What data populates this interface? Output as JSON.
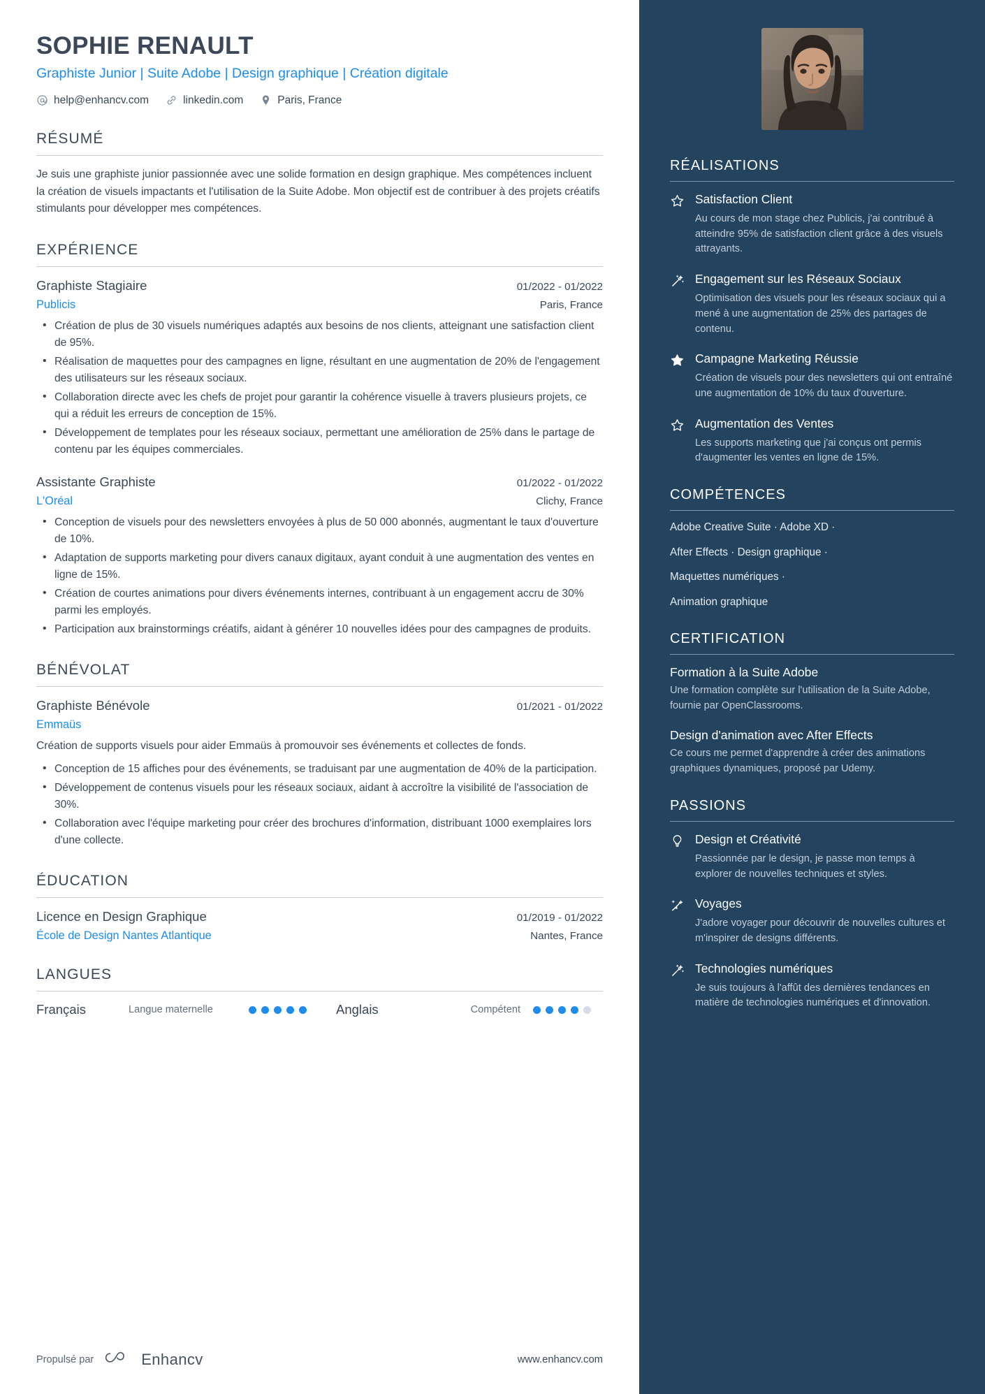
{
  "header": {
    "name": "SOPHIE RENAULT",
    "headline": "Graphiste Junior | Suite Adobe | Design graphique | Création digitale",
    "contacts": [
      {
        "icon": "at-icon",
        "text": "help@enhancv.com"
      },
      {
        "icon": "link-icon",
        "text": "linkedin.com"
      },
      {
        "icon": "location-pin-icon",
        "text": "Paris, France"
      }
    ]
  },
  "summary": {
    "title": "RÉSUMÉ",
    "text": "Je suis une graphiste junior passionnée avec une solide formation en design graphique. Mes compétences incluent la création de visuels impactants et l'utilisation de la Suite Adobe. Mon objectif est de contribuer à des projets créatifs stimulants pour développer mes compétences."
  },
  "experience": {
    "title": "EXPÉRIENCE",
    "entries": [
      {
        "role": "Graphiste Stagiaire",
        "date": "01/2022 - 01/2022",
        "company": "Publicis",
        "location": "Paris, France",
        "bullets": [
          "Création de plus de 30 visuels numériques adaptés aux besoins de nos clients, atteignant une satisfaction client de 95%.",
          "Réalisation de maquettes pour des campagnes en ligne, résultant en une augmentation de 20% de l'engagement des utilisateurs sur les réseaux sociaux.",
          "Collaboration directe avec les chefs de projet pour garantir la cohérence visuelle à travers plusieurs projets, ce qui a réduit les erreurs de conception de 15%.",
          "Développement de templates pour les réseaux sociaux, permettant une amélioration de 25% dans le partage de contenu par les équipes commerciales."
        ]
      },
      {
        "role": "Assistante Graphiste",
        "date": "01/2022 - 01/2022",
        "company": "L'Oréal",
        "location": "Clichy, France",
        "bullets": [
          "Conception de visuels pour des newsletters envoyées à plus de 50 000 abonnés, augmentant le taux d'ouverture de 10%.",
          "Adaptation de supports marketing pour divers canaux digitaux, ayant conduit à une augmentation des ventes en ligne de 15%.",
          "Création de courtes animations pour divers événements internes, contribuant à un engagement accru de 30% parmi les employés.",
          "Participation aux brainstormings créatifs, aidant à générer 10 nouvelles idées pour des campagnes de produits."
        ]
      }
    ]
  },
  "volunteering": {
    "title": "BÉNÉVOLAT",
    "entries": [
      {
        "role": "Graphiste Bénévole",
        "date": "01/2021 - 01/2022",
        "company": "Emmaüs",
        "location": "",
        "description": "Création de supports visuels pour aider Emmaüs à promouvoir ses événements et collectes de fonds.",
        "bullets": [
          "Conception de 15 affiches pour des événements, se traduisant par une augmentation de 40% de la participation.",
          "Développement de contenus visuels pour les réseaux sociaux, aidant à accroître la visibilité de l'association de 30%.",
          "Collaboration avec l'équipe marketing pour créer des brochures d'information, distribuant 1000 exemplaires lors d'une collecte."
        ]
      }
    ]
  },
  "education": {
    "title": "ÉDUCATION",
    "entries": [
      {
        "degree": "Licence en Design Graphique",
        "date": "01/2019 - 01/2022",
        "school": "École de Design Nantes Atlantique",
        "location": "Nantes, France"
      }
    ]
  },
  "languages": {
    "title": "LANGUES",
    "items": [
      {
        "name": "Français",
        "level": "Langue maternelle",
        "filled": 5,
        "total": 5
      },
      {
        "name": "Anglais",
        "level": "Compétent",
        "filled": 4,
        "total": 5
      }
    ]
  },
  "achievements": {
    "title": "RÉALISATIONS",
    "items": [
      {
        "icon": "star-outline-icon",
        "title": "Satisfaction Client",
        "description": "Au cours de mon stage chez Publicis, j'ai contribué à atteindre 95% de satisfaction client grâce à des visuels attrayants."
      },
      {
        "icon": "magic-wand-icon",
        "title": "Engagement sur les Réseaux Sociaux",
        "description": "Optimisation des visuels pour les réseaux sociaux qui a mené à une augmentation de 25% des partages de contenu."
      },
      {
        "icon": "star-filled-icon",
        "title": "Campagne Marketing Réussie",
        "description": "Création de visuels pour des newsletters qui ont entraîné une augmentation de 10% du taux d'ouverture."
      },
      {
        "icon": "star-outline-icon",
        "title": "Augmentation des Ventes",
        "description": "Les supports marketing que j'ai conçus ont permis d'augmenter les ventes en ligne de 15%."
      }
    ]
  },
  "skills": {
    "title": "COMPÉTENCES",
    "lines": [
      "Adobe Creative Suite · Adobe XD ·",
      "After Effects · Design graphique ·",
      "Maquettes numériques ·",
      "Animation graphique"
    ]
  },
  "certification": {
    "title": "CERTIFICATION",
    "items": [
      {
        "title": "Formation à la Suite Adobe",
        "description": "Une formation complète sur l'utilisation de la Suite Adobe, fournie par OpenClassrooms."
      },
      {
        "title": "Design d'animation avec After Effects",
        "description": "Ce cours me permet d'apprendre à créer des animations graphiques dynamiques, proposé par Udemy."
      }
    ]
  },
  "passions": {
    "title": "PASSIONS",
    "items": [
      {
        "icon": "lightbulb-icon",
        "title": "Design et Créativité",
        "description": "Passionnée par le design, je passe mon temps à explorer de nouvelles techniques et styles."
      },
      {
        "icon": "sparkle-trail-icon",
        "title": "Voyages",
        "description": "J'adore voyager pour découvrir de nouvelles cultures et m'inspirer de designs différents."
      },
      {
        "icon": "magic-wand-icon",
        "title": "Technologies numériques",
        "description": "Je suis toujours à l'affût des dernières tendances en matière de technologies numériques et d'innovation."
      }
    ]
  },
  "footer": {
    "powered_by": "Propulsé par",
    "brand": "Enhancv",
    "url": "www.enhancv.com"
  },
  "colors": {
    "accent_blue": "#1f8ceb",
    "sidebar_bg": "#23435f",
    "text_dark": "#3c4858"
  }
}
